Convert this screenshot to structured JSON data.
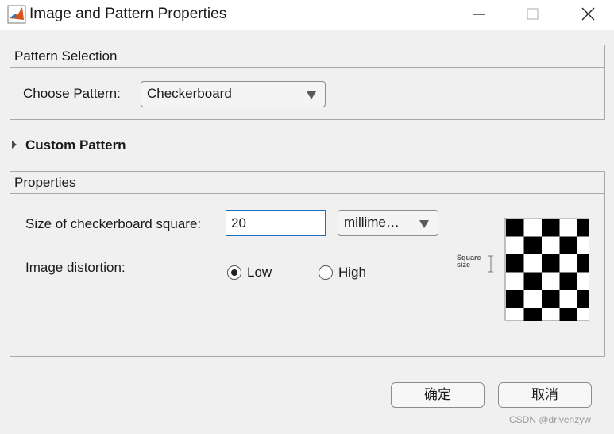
{
  "window": {
    "title": "Image and Pattern Properties"
  },
  "pattern_selection": {
    "header": "Pattern Selection",
    "choose_label": "Choose Pattern:",
    "selected_pattern": "Checkerboard"
  },
  "custom_pattern": {
    "label": "Custom Pattern"
  },
  "properties": {
    "header": "Properties",
    "square_size_label": "Size of checkerboard square:",
    "square_size_value": "20",
    "units_value": "millime…",
    "distortion_label": "Image distortion:",
    "distortion_options": [
      {
        "label": "Low",
        "selected": true
      },
      {
        "label": "High",
        "selected": false
      }
    ],
    "preview_caption_line1": "Square",
    "preview_caption_line2": "size"
  },
  "buttons": {
    "ok": "确定",
    "cancel": "取消"
  },
  "watermark": "CSDN @drivenzyw",
  "colors": {
    "background": "#f0f0f0",
    "input_border_focus": "#1e6ebf"
  }
}
